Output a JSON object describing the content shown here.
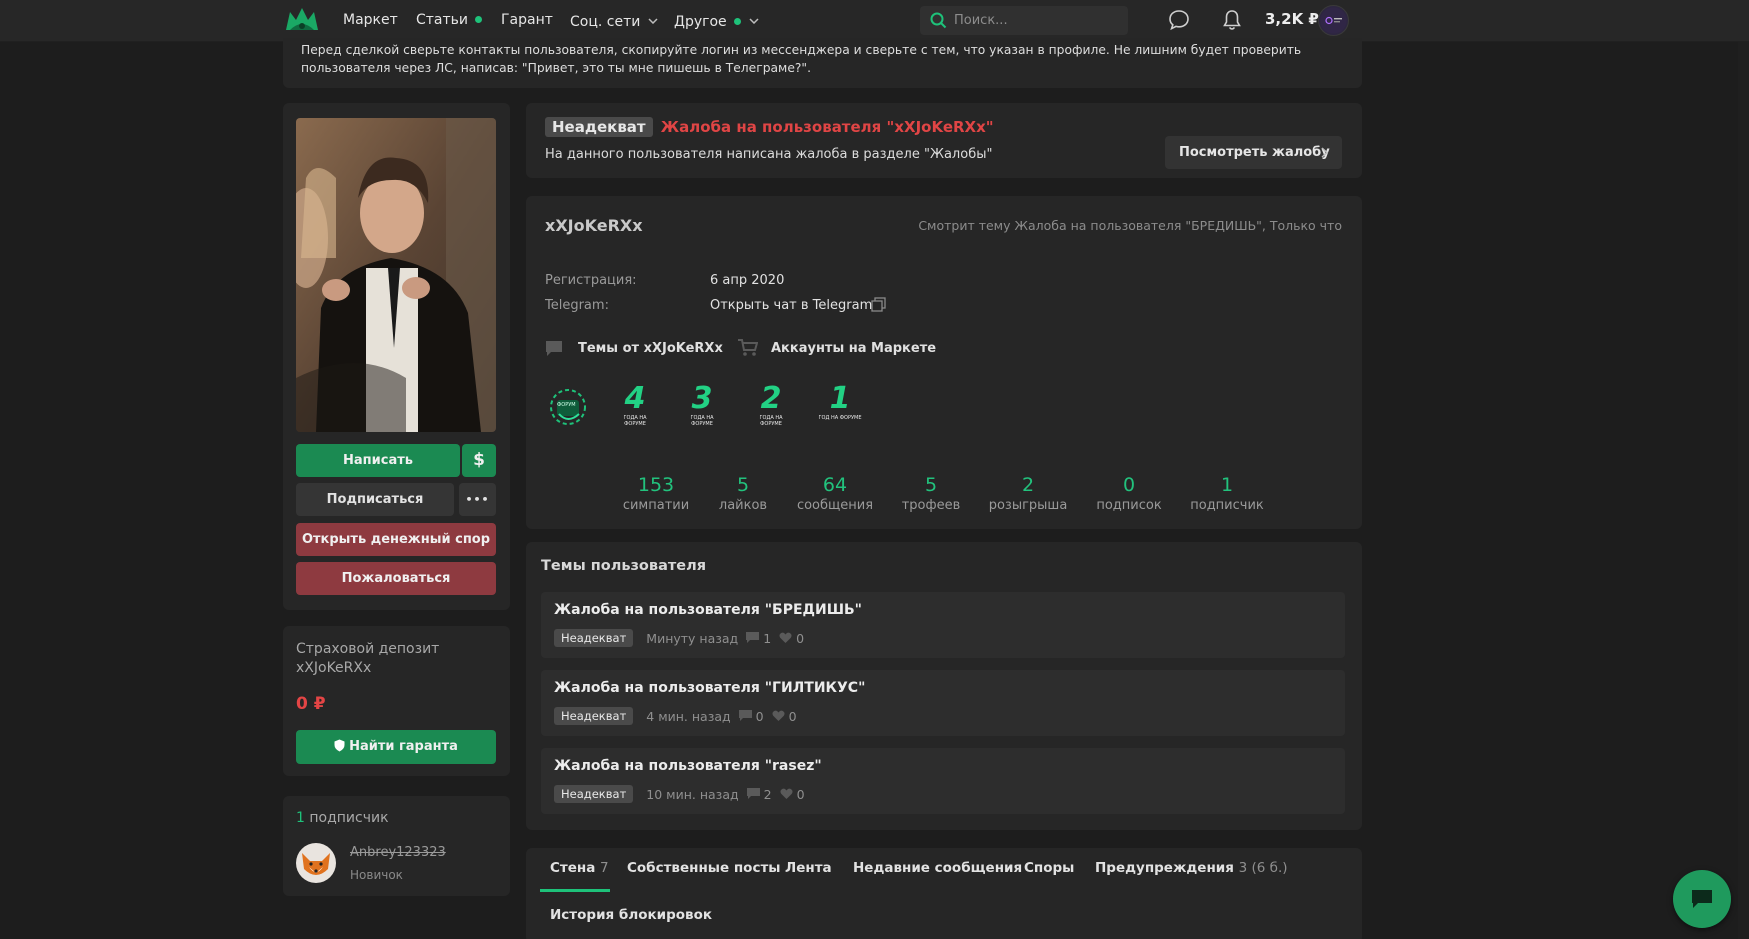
{
  "nav": {
    "items": [
      {
        "label": "Маркет"
      },
      {
        "label": "Статьи"
      },
      {
        "label": "Гарант"
      },
      {
        "label": "Соц. сети"
      },
      {
        "label": "Другое"
      }
    ],
    "search_placeholder": "Поиск...",
    "balance": "3,2K ₽",
    "accent_color": "#1ec27a"
  },
  "notice": {
    "text": "Перед сделкой сверьте контакты пользователя, скопируйте логин из мессенджера и сверьте с тем, что указан в профиле. Не лишним будет проверить пользователя через ЛС, написав: \"Привет, это ты мне пишешь в Телеграме?\"."
  },
  "sidebar": {
    "write_button": "Написать",
    "dollar_symbol": "$",
    "subscribe_button": "Подписаться",
    "more_symbol": "•••",
    "dispute_button": "Открыть денежный спор",
    "report_button": "Пожаловаться",
    "deposit_title": "Страховой депозит",
    "deposit_user": "xXJoKeRXx",
    "deposit_amount": "0 ₽",
    "find_guarantor_button": "Найти гаранта",
    "subscribers_count": "1",
    "subscribers_label": "подписчик",
    "subscriber": {
      "name": "Anbrey123323",
      "rank": "Новичок"
    }
  },
  "complaint": {
    "tag": "Неадекват",
    "title": "Жалоба на пользователя \"xXJoKeRXx\"",
    "subtitle": "На данного пользователя написана жалоба в разделе \"Жалобы\"",
    "button": "Посмотреть жалобу",
    "title_color": "#e04545"
  },
  "profile": {
    "username": "xXJoKeRXx",
    "activity": "Смотрит тему Жалоба на пользователя \"БРЕДИШЬ\", Только что",
    "reg_label": "Регистрация:",
    "reg_value": "6 апр 2020",
    "tg_label": "Telegram:",
    "tg_value": "Открыть чат в Telegram",
    "topics_link": "Темы от xXJoKeRXx",
    "market_link": "Аккаунты на Маркете",
    "badges": [
      {
        "digit": "",
        "text": "ФОРУМ"
      },
      {
        "digit": "4",
        "text": "ГОДА НА ФОРУМЕ"
      },
      {
        "digit": "3",
        "text": "ГОДА НА ФОРУМЕ"
      },
      {
        "digit": "2",
        "text": "ГОДА НА ФОРУМЕ"
      },
      {
        "digit": "1",
        "text": "ГОД НА ФОРУМЕ"
      }
    ],
    "stats": [
      {
        "num": "153",
        "label": "симпатии"
      },
      {
        "num": "5",
        "label": "лайков"
      },
      {
        "num": "64",
        "label": "сообщения"
      },
      {
        "num": "5",
        "label": "трофеев"
      },
      {
        "num": "2",
        "label": "розыгрыша"
      },
      {
        "num": "0",
        "label": "подписок"
      },
      {
        "num": "1",
        "label": "подписчик"
      }
    ]
  },
  "topics": {
    "heading": "Темы пользователя",
    "items": [
      {
        "title": "Жалоба на пользователя \"БРЕДИШЬ\"",
        "tag": "Неадекват",
        "time": "Минуту назад",
        "comments": "1",
        "likes": "0"
      },
      {
        "title": "Жалоба на пользователя \"ГИЛТИКУС\"",
        "tag": "Неадекват",
        "time": "4 мин. назад",
        "comments": "0",
        "likes": "0"
      },
      {
        "title": "Жалоба на пользователя \"rasez\"",
        "tag": "Неадекват",
        "time": "10 мин. назад",
        "comments": "2",
        "likes": "0"
      }
    ]
  },
  "tabs": [
    {
      "label": "Стена",
      "count": "7"
    },
    {
      "label": "Собственные посты",
      "count": ""
    },
    {
      "label": "Лента",
      "count": ""
    },
    {
      "label": "Недавние сообщения",
      "count": ""
    },
    {
      "label": "Споры",
      "count": ""
    },
    {
      "label": "Предупреждения",
      "count": "3 (6 б.)"
    },
    {
      "label": "История блокировок",
      "count": ""
    }
  ]
}
